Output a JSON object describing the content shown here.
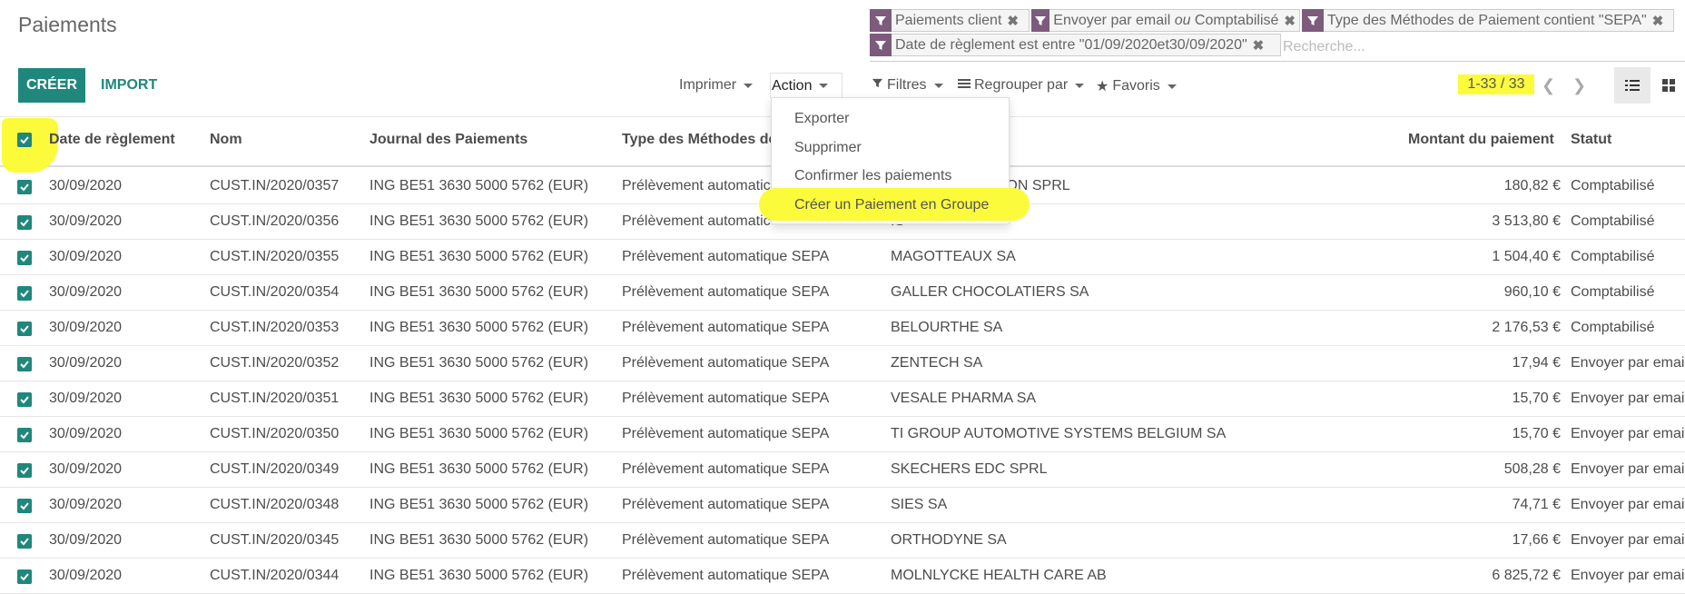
{
  "page": {
    "title": "Paiements"
  },
  "search": {
    "facets": [
      "Paiements client",
      "Envoyer par email ou Comptabilisé",
      "Type des Méthodes de Paiement contient \"SEPA\"",
      "Date de règlement est entre \"01/09/2020et30/09/2020\""
    ],
    "facet_parts": {
      "envoyer": "Envoyer par email ",
      "ou": "ou",
      "comptabilise": " Comptabilisé"
    },
    "placeholder": "Recherche..."
  },
  "toolbar": {
    "create_label": "CRÉER",
    "import_label": "IMPORT",
    "print_label": "Imprimer",
    "action_label": "Action",
    "filters_label": "Filtres",
    "groupby_label": "Regrouper par",
    "favorites_label": "Favoris",
    "pager": "1-33 / 33"
  },
  "action_menu": [
    "Exporter",
    "Supprimer",
    "Confirmer les paiements",
    "Créer un Paiement en Groupe"
  ],
  "table": {
    "columns": [
      "Date de règlement",
      "Nom",
      "Journal des Paiements",
      "Type des Méthodes de",
      "Montant du paiement",
      "Statut"
    ],
    "rows": [
      {
        "date": "30/09/2020",
        "name": "CUST.IN/2020/0357",
        "journal": "ING BE51 3630 5000 5762 (EUR)",
        "type": "Prélèvement automatic",
        "partner": "ANCED FILTRATION SPRL",
        "amount": "180,82 €",
        "status": "Comptabilisé"
      },
      {
        "date": "30/09/2020",
        "name": "CUST.IN/2020/0356",
        "journal": "ING BE51 3630 5000 5762 (EUR)",
        "type": "Prélèvement automatic",
        "partner": "IS",
        "amount": "3 513,80 €",
        "status": "Comptabilisé"
      },
      {
        "date": "30/09/2020",
        "name": "CUST.IN/2020/0355",
        "journal": "ING BE51 3630 5000 5762 (EUR)",
        "type": "Prélèvement automatique SEPA",
        "partner": "MAGOTTEAUX SA",
        "amount": "1 504,40 €",
        "status": "Comptabilisé"
      },
      {
        "date": "30/09/2020",
        "name": "CUST.IN/2020/0354",
        "journal": "ING BE51 3630 5000 5762 (EUR)",
        "type": "Prélèvement automatique SEPA",
        "partner": "GALLER CHOCOLATIERS SA",
        "amount": "960,10 €",
        "status": "Comptabilisé"
      },
      {
        "date": "30/09/2020",
        "name": "CUST.IN/2020/0353",
        "journal": "ING BE51 3630 5000 5762 (EUR)",
        "type": "Prélèvement automatique SEPA",
        "partner": "BELOURTHE SA",
        "amount": "2 176,53 €",
        "status": "Comptabilisé"
      },
      {
        "date": "30/09/2020",
        "name": "CUST.IN/2020/0352",
        "journal": "ING BE51 3630 5000 5762 (EUR)",
        "type": "Prélèvement automatique SEPA",
        "partner": "ZENTECH SA",
        "amount": "17,94 €",
        "status": "Envoyer par email"
      },
      {
        "date": "30/09/2020",
        "name": "CUST.IN/2020/0351",
        "journal": "ING BE51 3630 5000 5762 (EUR)",
        "type": "Prélèvement automatique SEPA",
        "partner": "VESALE PHARMA SA",
        "amount": "15,70 €",
        "status": "Envoyer par email"
      },
      {
        "date": "30/09/2020",
        "name": "CUST.IN/2020/0350",
        "journal": "ING BE51 3630 5000 5762 (EUR)",
        "type": "Prélèvement automatique SEPA",
        "partner": "TI GROUP AUTOMOTIVE SYSTEMS BELGIUM SA",
        "amount": "15,70 €",
        "status": "Envoyer par email"
      },
      {
        "date": "30/09/2020",
        "name": "CUST.IN/2020/0349",
        "journal": "ING BE51 3630 5000 5762 (EUR)",
        "type": "Prélèvement automatique SEPA",
        "partner": "SKECHERS EDC SPRL",
        "amount": "508,28 €",
        "status": "Envoyer par email"
      },
      {
        "date": "30/09/2020",
        "name": "CUST.IN/2020/0348",
        "journal": "ING BE51 3630 5000 5762 (EUR)",
        "type": "Prélèvement automatique SEPA",
        "partner": "SIES SA",
        "amount": "74,71 €",
        "status": "Envoyer par email"
      },
      {
        "date": "30/09/2020",
        "name": "CUST.IN/2020/0345",
        "journal": "ING BE51 3630 5000 5762 (EUR)",
        "type": "Prélèvement automatique SEPA",
        "partner": "ORTHODYNE SA",
        "amount": "17,66 €",
        "status": "Envoyer par email"
      },
      {
        "date": "30/09/2020",
        "name": "CUST.IN/2020/0344",
        "journal": "ING BE51 3630 5000 5762 (EUR)",
        "type": "Prélèvement automatique SEPA",
        "partner": "MOLNLYCKE HEALTH CARE AB",
        "amount": "6 825,72 €",
        "status": "Envoyer par email"
      }
    ]
  },
  "colors": {
    "accent": "#20877c",
    "facet": "#7c5b7c",
    "highlight": "#fbfb3c"
  }
}
